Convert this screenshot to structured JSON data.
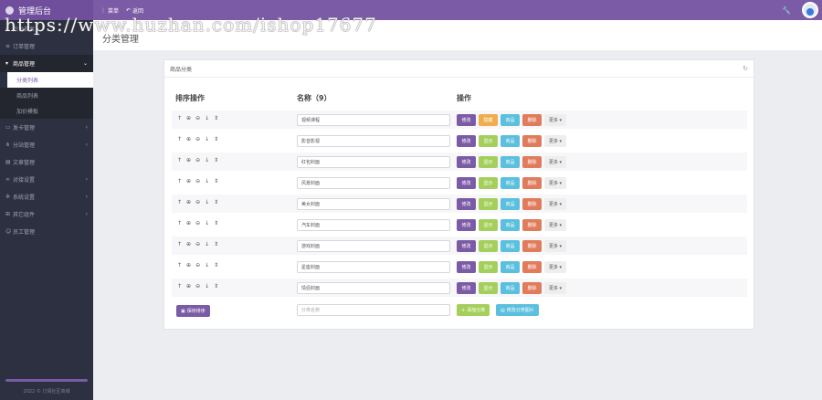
{
  "app": {
    "title": "管理后台"
  },
  "topnav": {
    "menu_label": "菜单",
    "back_label": "返回"
  },
  "watermark": "https://www.huzhan.com/ishop17677",
  "sidebar": {
    "items": [
      {
        "label": "后台首页",
        "icon": "home-icon"
      },
      {
        "label": "订单管理",
        "icon": "list-icon"
      },
      {
        "label": "商品管理",
        "icon": "cart-icon",
        "open": true,
        "children": [
          "分类列表",
          "商品列表",
          "加价模板"
        ]
      },
      {
        "label": "发卡管理",
        "icon": "card-icon"
      },
      {
        "label": "分站管理",
        "icon": "sitemap-icon"
      },
      {
        "label": "文章管理",
        "icon": "doc-icon"
      },
      {
        "label": "对接设置",
        "icon": "link-icon"
      },
      {
        "label": "系统设置",
        "icon": "gear-icon"
      },
      {
        "label": "其它组件",
        "icon": "puzzle-icon"
      },
      {
        "label": "员工管理",
        "icon": "user-icon"
      }
    ],
    "copyright": "2022 © 订阅社区商城"
  },
  "page": {
    "title": "分类管理"
  },
  "card": {
    "title": "商品分类"
  },
  "table": {
    "col_sort": "排序操作",
    "col_name": "名称（9）",
    "col_actions": "操作",
    "rows": [
      {
        "name": "视频课程",
        "show": "隐藏",
        "show_state": "hidden"
      },
      {
        "name": "影音影视",
        "show": "显示",
        "show_state": "shown"
      },
      {
        "name": "红包封面",
        "show": "显示",
        "show_state": "shown"
      },
      {
        "name": "风景封面",
        "show": "显示",
        "show_state": "shown"
      },
      {
        "name": "美女封面",
        "show": "显示",
        "show_state": "shown"
      },
      {
        "name": "汽车封面",
        "show": "显示",
        "show_state": "shown"
      },
      {
        "name": "游戏封面",
        "show": "显示",
        "show_state": "shown"
      },
      {
        "name": "星座封面",
        "show": "显示",
        "show_state": "shown"
      },
      {
        "name": "情侣封面",
        "show": "显示",
        "show_state": "shown"
      }
    ],
    "btn_edit": "修改",
    "btn_prod": "商品",
    "btn_del": "删除",
    "btn_more": "更多 ▾"
  },
  "footer_actions": {
    "save": "保存排序",
    "new_placeholder": "分类名称",
    "add": "添加分类",
    "pics": "修改分类图片"
  },
  "colors": {
    "accent": "#7b5ba6",
    "sidebar_bg": "#2d3040"
  }
}
